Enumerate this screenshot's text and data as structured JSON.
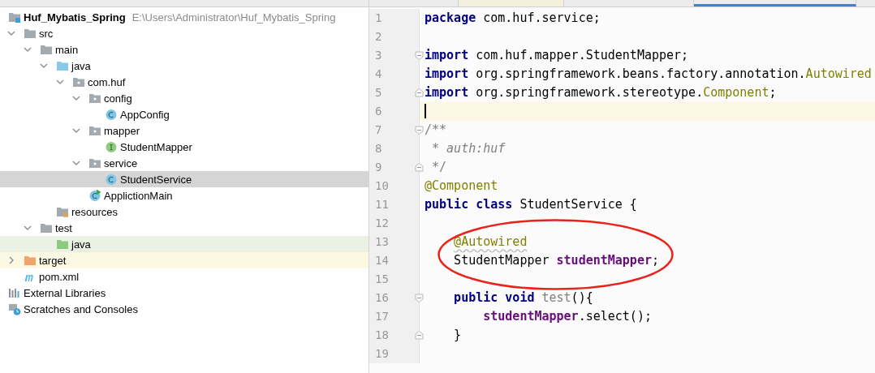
{
  "project_tree": [
    {
      "label": "Huf_Mybatis_Spring",
      "path": "E:\\Users\\Administrator\\Huf_Mybatis_Spring",
      "kind": "module",
      "selected": false,
      "children": [
        {
          "label": "src",
          "kind": "folder",
          "expanded": true,
          "selected": false,
          "children": [
            {
              "label": "main",
              "kind": "folder",
              "expanded": true,
              "selected": false,
              "children": [
                {
                  "label": "java",
                  "kind": "source-folder",
                  "expanded": true,
                  "selected": false,
                  "children": [
                    {
                      "label": "com.huf",
                      "kind": "package",
                      "expanded": true,
                      "selected": false,
                      "children": [
                        {
                          "label": "config",
                          "kind": "package",
                          "expanded": true,
                          "selected": false,
                          "children": [
                            {
                              "label": "AppConfig",
                              "kind": "class",
                              "selected": false
                            }
                          ]
                        },
                        {
                          "label": "mapper",
                          "kind": "package",
                          "expanded": true,
                          "selected": false,
                          "children": [
                            {
                              "label": "StudentMapper",
                              "kind": "interface",
                              "selected": false
                            }
                          ]
                        },
                        {
                          "label": "service",
                          "kind": "package",
                          "expanded": true,
                          "selected": false,
                          "children": [
                            {
                              "label": "StudentService",
                              "kind": "class",
                              "selected": true
                            }
                          ]
                        },
                        {
                          "label": "ApplictionMain",
                          "kind": "main-class",
                          "selected": false
                        }
                      ]
                    }
                  ]
                },
                {
                  "label": "resources",
                  "kind": "resources",
                  "selected": false
                }
              ]
            },
            {
              "label": "test",
              "kind": "folder",
              "expanded": true,
              "selected": false,
              "children": [
                {
                  "label": "java",
                  "kind": "test-folder",
                  "selected": false
                }
              ]
            }
          ]
        },
        {
          "label": "target",
          "kind": "excluded-folder",
          "expanded": false,
          "selected": false
        },
        {
          "label": "pom.xml",
          "kind": "maven",
          "selected": false
        }
      ]
    },
    {
      "label": "External Libraries",
      "kind": "libraries",
      "selected": false
    },
    {
      "label": "Scratches and Consoles",
      "kind": "scratches",
      "selected": false
    }
  ],
  "editor": {
    "lines": [
      {
        "number": "1",
        "tokens": [
          {
            "text": "package",
            "kind": "keyword"
          },
          {
            "text": " com.huf.service;",
            "kind": "plain"
          }
        ]
      },
      {
        "number": "2"
      },
      {
        "number": "3",
        "fold_start": true,
        "tokens": [
          {
            "text": "import",
            "kind": "keyword"
          },
          {
            "text": " com.huf.mapper.StudentMapper;",
            "kind": "plain"
          }
        ]
      },
      {
        "number": "4",
        "tokens": [
          {
            "text": "import",
            "kind": "keyword"
          },
          {
            "text": " org.springframework.beans.factory.annotation.",
            "kind": "plain"
          },
          {
            "text": "Autowired",
            "kind": "annotation"
          }
        ]
      },
      {
        "number": "5",
        "fold_end": true,
        "tokens": [
          {
            "text": "import",
            "kind": "keyword"
          },
          {
            "text": " org.springframework.stereotype.",
            "kind": "plain"
          },
          {
            "text": "Component",
            "kind": "annotation"
          },
          {
            "text": ";",
            "kind": "plain"
          }
        ]
      },
      {
        "number": "6",
        "current": true
      },
      {
        "number": "7",
        "fold_start": true,
        "tokens": [
          {
            "text": "/**",
            "kind": "comment"
          }
        ]
      },
      {
        "number": "8",
        "tokens": [
          {
            "text": " * ",
            "kind": "comment"
          },
          {
            "text": "auth:huf",
            "kind": "doc"
          }
        ]
      },
      {
        "number": "9",
        "fold_end": true,
        "tokens": [
          {
            "text": " */",
            "kind": "comment"
          }
        ]
      },
      {
        "number": "10",
        "tokens": [
          {
            "text": "@Component",
            "kind": "annotation"
          }
        ]
      },
      {
        "number": "11",
        "tokens": [
          {
            "text": "public class",
            "kind": "keyword"
          },
          {
            "text": " StudentService {",
            "kind": "plain"
          }
        ]
      },
      {
        "number": "12"
      },
      {
        "number": "13",
        "in_class": true,
        "tokens": [
          {
            "text": "@Autowired",
            "kind": "warning"
          }
        ]
      },
      {
        "number": "14",
        "in_class": true,
        "tokens": [
          {
            "text": "StudentMapper ",
            "kind": "plain"
          },
          {
            "text": "studentMapper",
            "kind": "field"
          },
          {
            "text": ";",
            "kind": "plain"
          }
        ]
      },
      {
        "number": "15"
      },
      {
        "number": "16",
        "in_class": true,
        "fold_start": true,
        "tokens": [
          {
            "text": "public void",
            "kind": "keyword"
          },
          {
            "text": " test",
            "kind": "unused"
          },
          {
            "text": "(){",
            "kind": "plain"
          }
        ]
      },
      {
        "number": "17",
        "in_class": true,
        "in_method": true,
        "tokens": [
          {
            "text": "studentMapper",
            "kind": "field"
          },
          {
            "text": ".select();",
            "kind": "plain"
          }
        ]
      },
      {
        "number": "18",
        "in_class": true,
        "fold_end": true,
        "tokens": [
          {
            "text": "}",
            "kind": "plain"
          }
        ]
      },
      {
        "number": "19"
      }
    ]
  }
}
